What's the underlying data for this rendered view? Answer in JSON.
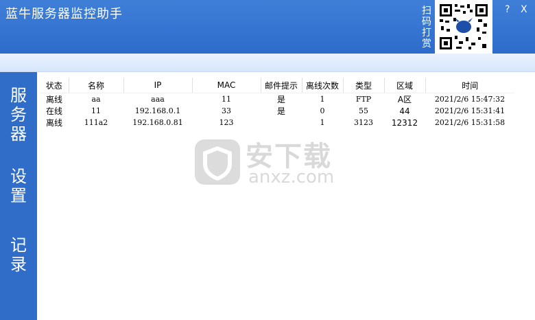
{
  "app": {
    "title": "蓝牛服务器监控助手"
  },
  "qr": {
    "label": "扫码打赏"
  },
  "window_controls": {
    "help": "?",
    "close": "X"
  },
  "sidebar": {
    "items": [
      {
        "label": "服务器"
      },
      {
        "label": "设置"
      },
      {
        "label": "记录"
      }
    ]
  },
  "table": {
    "headers": [
      "状态",
      "名称",
      "IP",
      "MAC",
      "邮件提示",
      "离线次数",
      "类型",
      "区域",
      "时间"
    ],
    "rows": [
      [
        "离线",
        "aa",
        "aaa",
        "11",
        "是",
        "1",
        "FTP",
        "A区",
        "2021/2/6 15:47:32"
      ],
      [
        "在线",
        "11",
        "192.168.0.1",
        "33",
        "是",
        "0",
        "55",
        "44",
        "2021/2/6 15:31:41"
      ],
      [
        "离线",
        "111a2",
        "192.168.0.81",
        "123",
        "",
        "1",
        "3123",
        "12312",
        "2021/2/6 15:31:58"
      ]
    ]
  },
  "watermark": {
    "text": "安下载",
    "sub": "anxz.com"
  }
}
